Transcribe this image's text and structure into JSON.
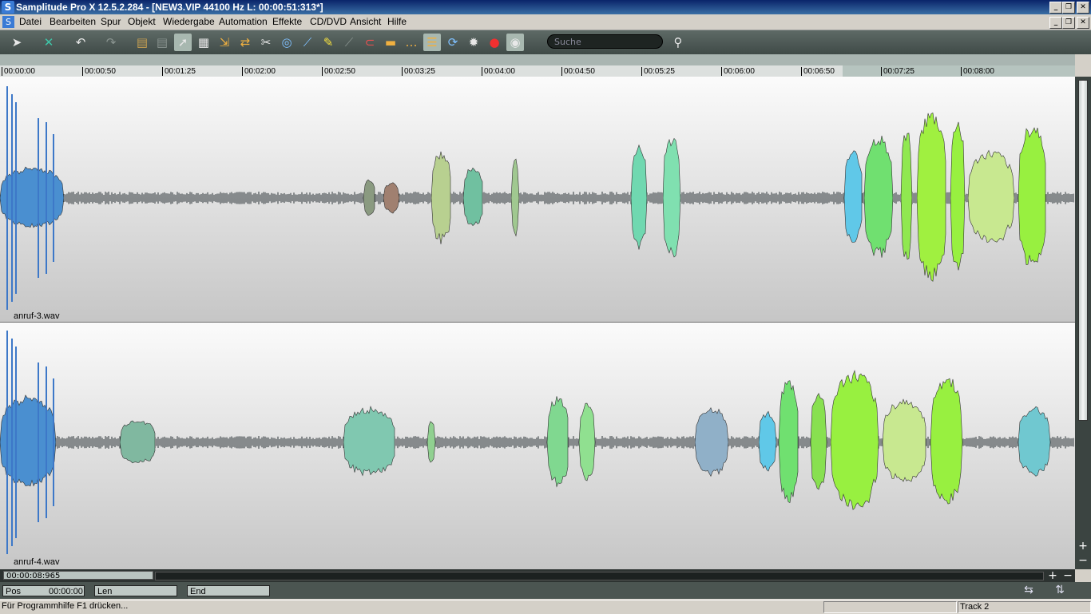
{
  "window": {
    "title": "Samplitude Pro X 12.5.2.284 - [NEW3.VIP   44100 Hz L: 00:00:51:313*]",
    "app_icon": "S"
  },
  "menu": [
    "Datei",
    "Bearbeiten",
    "Spur",
    "Objekt",
    "Wiedergabe",
    "Automation",
    "Effekte",
    "CD/DVD",
    "Ansicht",
    "Hilfe"
  ],
  "toolbar": {
    "icons": [
      "pointer-icon",
      "cross-tool-icon",
      "undo-icon",
      "redo-icon",
      "track-icon",
      "track-list-icon",
      "select-icon",
      "grid-icon",
      "range-icon",
      "object-icon",
      "cut-icon",
      "zoom-icon",
      "curve-icon",
      "pencil-icon",
      "eraser-icon",
      "magnet-icon",
      "snap-icon",
      "marker-icon",
      "overlay-icon",
      "loop-icon",
      "settings-icon",
      "record-icon",
      "monitor-icon",
      "search-icon"
    ],
    "search_placeholder": "Suche"
  },
  "ruler": {
    "labels": [
      "00:00:00",
      "00:00:50",
      "00:01:25",
      "00:02:00",
      "00:02:50",
      "00:03:25",
      "00:04:00",
      "00:04:50",
      "00:05:25",
      "00:06:00",
      "00:06:50",
      "00:07:25",
      "00:08:00"
    ]
  },
  "tracks": [
    {
      "name": "anruf-3.wav"
    },
    {
      "name": "anruf-4.wav"
    }
  ],
  "scroll": {
    "position": "00:00:08:965"
  },
  "position_bar": {
    "pos_label": "Pos",
    "pos_value": "00:00:00",
    "len_label": "Len",
    "end_label": "End"
  },
  "status": {
    "help": "Für Programmhilfe F1 drücken...",
    "track": "Track 2"
  },
  "colors": {
    "titlebar": "#0a246a",
    "toolbar": "#4e5956",
    "track_bg": "#e6e6e6"
  }
}
